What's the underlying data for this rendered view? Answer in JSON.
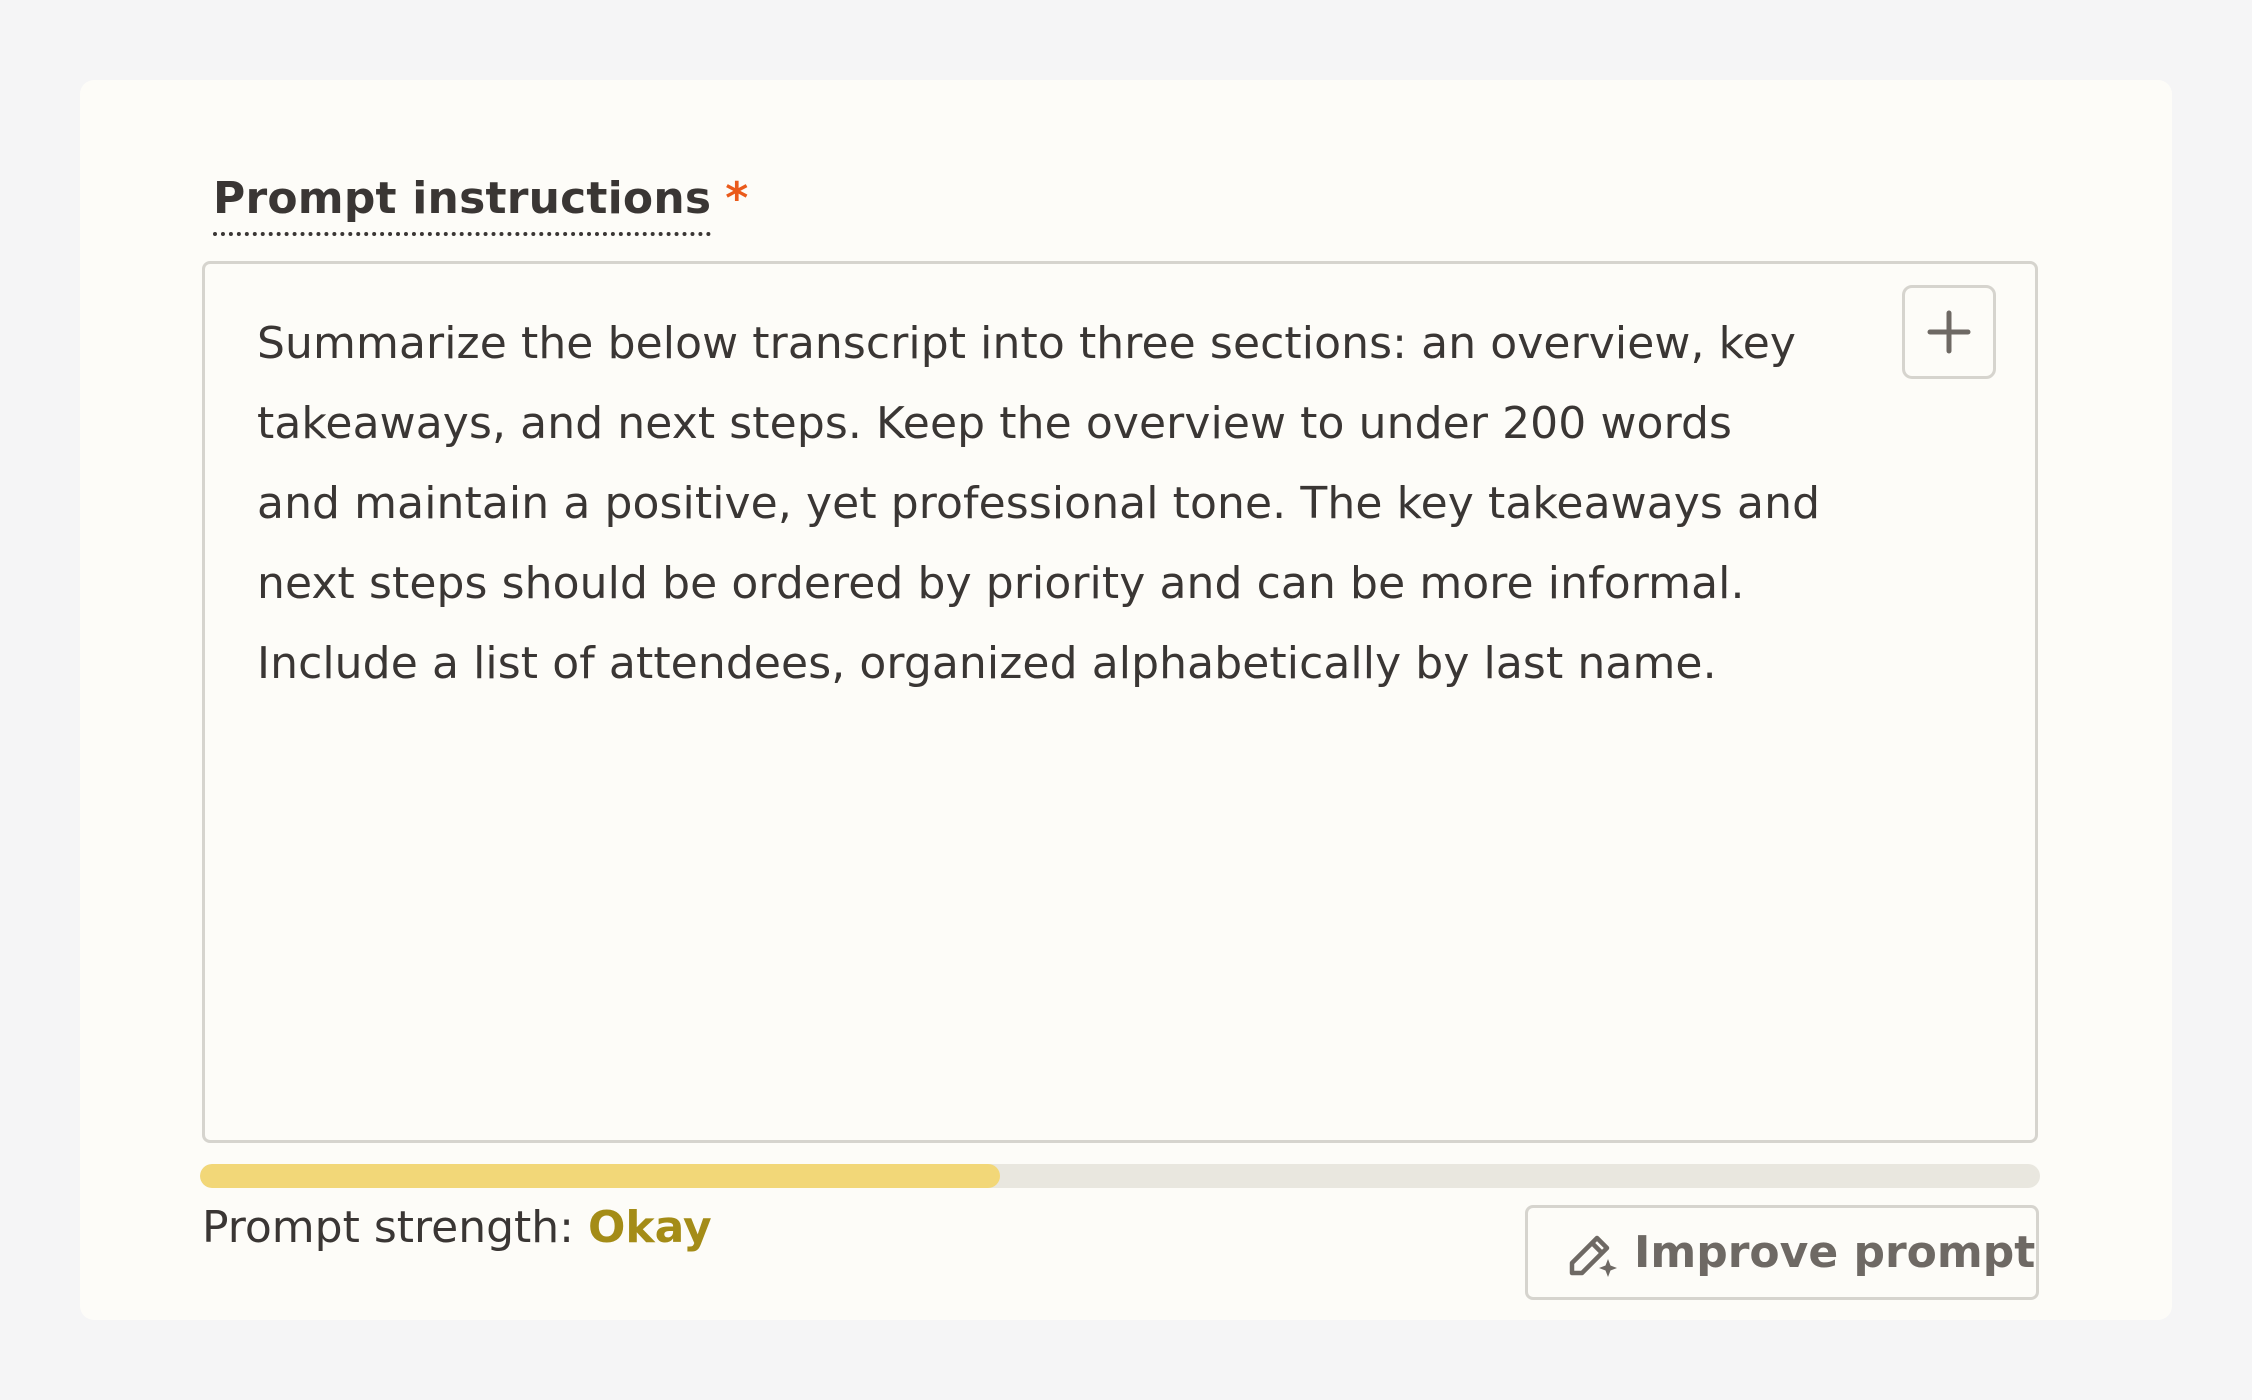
{
  "field": {
    "label": "Prompt instructions",
    "required_marker": "*",
    "value": "Summarize the below transcript into three sections: an overview, key takeaways, and next steps. Keep the overview to under 200 words and maintain a positive, yet professional tone. The key takeaways and next steps should be ordered by priority and can be more informal. Include a list of attendees, organized alphabetically by last name.",
    "add_button_icon": "plus-icon"
  },
  "strength": {
    "label": "Prompt strength:",
    "value": "Okay",
    "level_fraction": 0.435,
    "fill_color": "#f2d778",
    "value_color": "#a48c17"
  },
  "improve": {
    "label": "Improve prompt",
    "icon": "magic-pencil-icon"
  },
  "colors": {
    "required": "#ea5a1b",
    "card_background": "#fdfcf8",
    "page_background": "#f5f5f6"
  }
}
